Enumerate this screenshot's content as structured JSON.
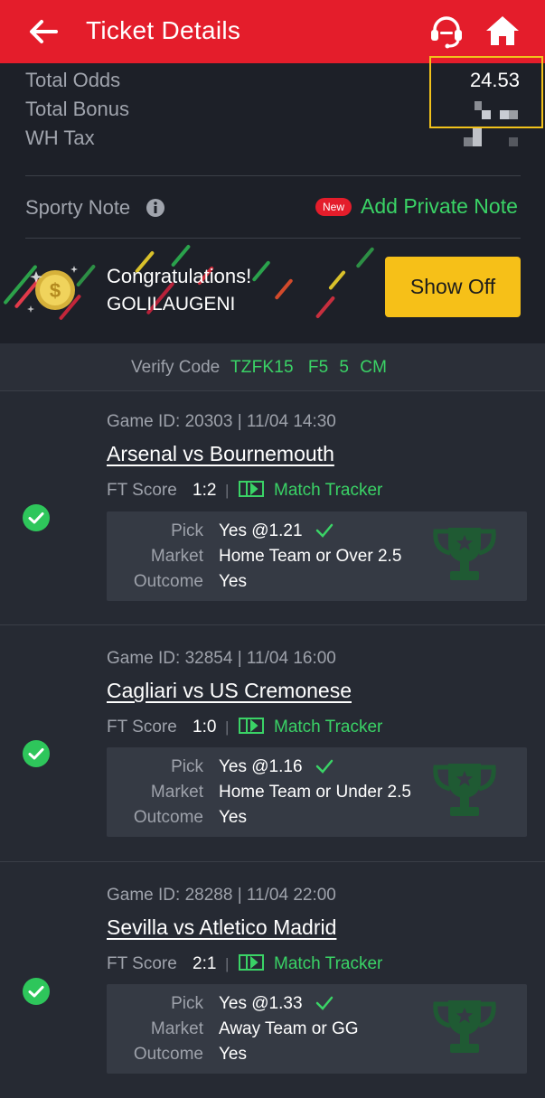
{
  "header": {
    "title": "Ticket Details"
  },
  "summary": {
    "total_odds_label": "Total Odds",
    "total_odds_value": "24.53",
    "total_bonus_label": "Total Bonus",
    "wh_tax_label": "WH Tax"
  },
  "note": {
    "label": "Sporty Note",
    "new_badge": "New",
    "add_label": "Add Private Note"
  },
  "promo": {
    "congrats": "Congratulations!",
    "username": "GOLILAUGENI",
    "show_off_label": "Show Off"
  },
  "verify": {
    "label": "Verify Code",
    "code": "TZFK15    F5   5   CM"
  },
  "games": [
    {
      "meta": "Game ID: 20303 | 11/04 14:30",
      "teams": "Arsenal vs Bournemouth",
      "ft_label": "FT Score",
      "ft_score": "1:2",
      "tracker_label": "Match Tracker",
      "pick_label": "Pick",
      "pick_value": "Yes @1.21",
      "market_label": "Market",
      "market_value": "Home Team or Over 2.5",
      "outcome_label": "Outcome",
      "outcome_value": "Yes"
    },
    {
      "meta": "Game ID: 32854 | 11/04 16:00",
      "teams": "Cagliari vs US Cremonese",
      "ft_label": "FT Score",
      "ft_score": "1:0",
      "tracker_label": "Match Tracker",
      "pick_label": "Pick",
      "pick_value": "Yes @1.16",
      "market_label": "Market",
      "market_value": "Home Team or Under 2.5",
      "outcome_label": "Outcome",
      "outcome_value": "Yes"
    },
    {
      "meta": "Game ID: 28288 | 11/04 22:00",
      "teams": "Sevilla vs Atletico Madrid",
      "ft_label": "FT Score",
      "ft_score": "2:1",
      "tracker_label": "Match Tracker",
      "pick_label": "Pick",
      "pick_value": "Yes @1.33",
      "market_label": "Market",
      "market_value": "Away Team or GG",
      "outcome_label": "Outcome",
      "outcome_value": "Yes"
    }
  ],
  "colors": {
    "header_red": "#e41d2b",
    "accent_green": "#3ad366",
    "button_yellow": "#f6c018",
    "trophy_green": "#1f5a33"
  },
  "icons": [
    "back-arrow-icon",
    "headset-icon",
    "home-icon",
    "info-icon",
    "coin-icon",
    "check-circle-icon",
    "match-tracker-icon",
    "checkmark-icon",
    "trophy-icon"
  ]
}
